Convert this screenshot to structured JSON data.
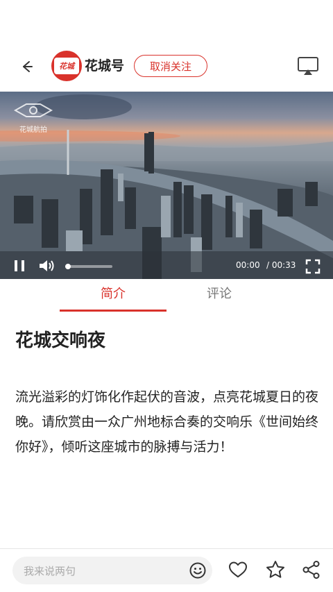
{
  "header": {
    "channel_name": "花城号",
    "logo_text": "花城",
    "unfollow_label": "取消关注"
  },
  "video": {
    "watermark": "花城航拍",
    "current_time": "00:00",
    "total_time": "/ 00:33",
    "progress": 0.0
  },
  "tabs": [
    {
      "label": "简介",
      "active": true
    },
    {
      "label": "评论",
      "active": false
    }
  ],
  "article": {
    "title": "花城交响夜",
    "description": "流光溢彩的灯饰化作起伏的音波，点亮花城夏日的夜晚。请欣赏由一众广州地标合奏的交响乐《世间始终你好》，倾听这座城市的脉搏与活力！"
  },
  "bottom_bar": {
    "comment_placeholder": "我来说两句"
  },
  "colors": {
    "accent": "#d9322b"
  }
}
